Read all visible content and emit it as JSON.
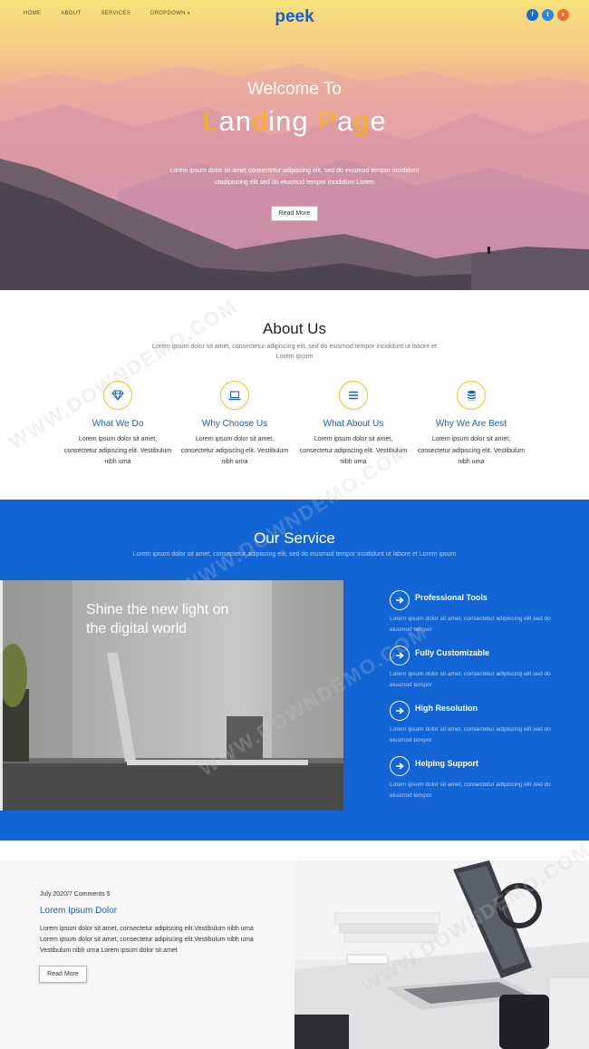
{
  "nav": {
    "items": [
      {
        "label": "HOME"
      },
      {
        "label": "ABOUT"
      },
      {
        "label": "SERVICES"
      },
      {
        "label": "DROPDOWN"
      }
    ],
    "brand": "peek",
    "social": [
      {
        "icon": "facebook-icon",
        "glyph": "f",
        "color": "#1a6bd1"
      },
      {
        "icon": "twitter-icon",
        "glyph": "t",
        "color": "#2a86e0"
      },
      {
        "icon": "rss-icon",
        "glyph": "r",
        "color": "#f06c2e"
      }
    ]
  },
  "hero": {
    "subtitle": "Welcome To",
    "title_parts": [
      "L",
      "an",
      "d",
      "ing ",
      "P",
      "a",
      "g",
      "e"
    ],
    "text": "Lorem ipsum dolor sit amet consectetur adipiscing elit, sed do eiusmod tempor incididunt utadipiscing elit sed do eiusmod tempor incididunt Lorem",
    "button": "Read More",
    "accent": "#f7b21a"
  },
  "about": {
    "title": "About Us",
    "text": "Lorem ipsum dolor sit amet, consectetur adipiscing elit, sed do eiusmod tempor incididunt ut labore et Lorem ipsum",
    "features": [
      {
        "icon": "diamond-icon",
        "title": "What We Do",
        "text": "Lorem ipsum dolor sit amet, consectetur adipiscing elit. Vestibulum nibh urna"
      },
      {
        "icon": "laptop-icon",
        "title": "Why Choose Us",
        "text": "Lorem ipsum dolor sit amet, consectetur adipiscing elit. Vestibulum nibh urna"
      },
      {
        "icon": "list-icon",
        "title": "What About Us",
        "text": "Lorem ipsum dolor sit amet, consectetur adipiscing elit. Vestibulum nibh urna"
      },
      {
        "icon": "database-icon",
        "title": "Why We Are Best",
        "text": "Lorem ipsum dolor sit amet, consectetur adipiscing elit. Vestibulum nibh urna"
      }
    ]
  },
  "service": {
    "title": "Our Service",
    "text": "Lorem ipsum dolor sit amet, consectetur adipiscing elit, sed do eiusmod tempor incididunt ut labore et Lorem ipsum",
    "image_caption_line1": "Shine the new light on",
    "image_caption_line2": "the digital world",
    "items": [
      {
        "title": "Professional Tools",
        "text": "Lorem ipsum dolor sit amet, consectetur adipiscing elit sed do eiusmod tempor"
      },
      {
        "title": "Fully Customizable",
        "text": "Lorem ipsum dolor sit amet, consectetur adipiscing elit sed do eiusmod tempor"
      },
      {
        "title": "High Resolution",
        "text": "Lorem ipsum dolor sit amet, consectetur adipiscing elit sed do eiusmod tempor"
      },
      {
        "title": "Helping Support",
        "text": "Lorem ipsum dolor sit amet, consectetur adipiscing elit sed do eiusmod tempor"
      }
    ],
    "background": "#1365d6"
  },
  "blog": {
    "meta": "July 2020/7 Comments 5",
    "title": "Lorem Ipsum Dolor",
    "text": "Lorem ipsum dolor sit amet, consectetur adipiscing elit.Vestibulum nibh urna Lorem ipsum dolor sit amet, consectetur adipiscing elit.Vestibulum nibh urna Vestibulum nibh urna Lorem ipsum dolor sit amet",
    "button": "Read More"
  },
  "watermark": "WWW.DOWNDEMO.COM"
}
